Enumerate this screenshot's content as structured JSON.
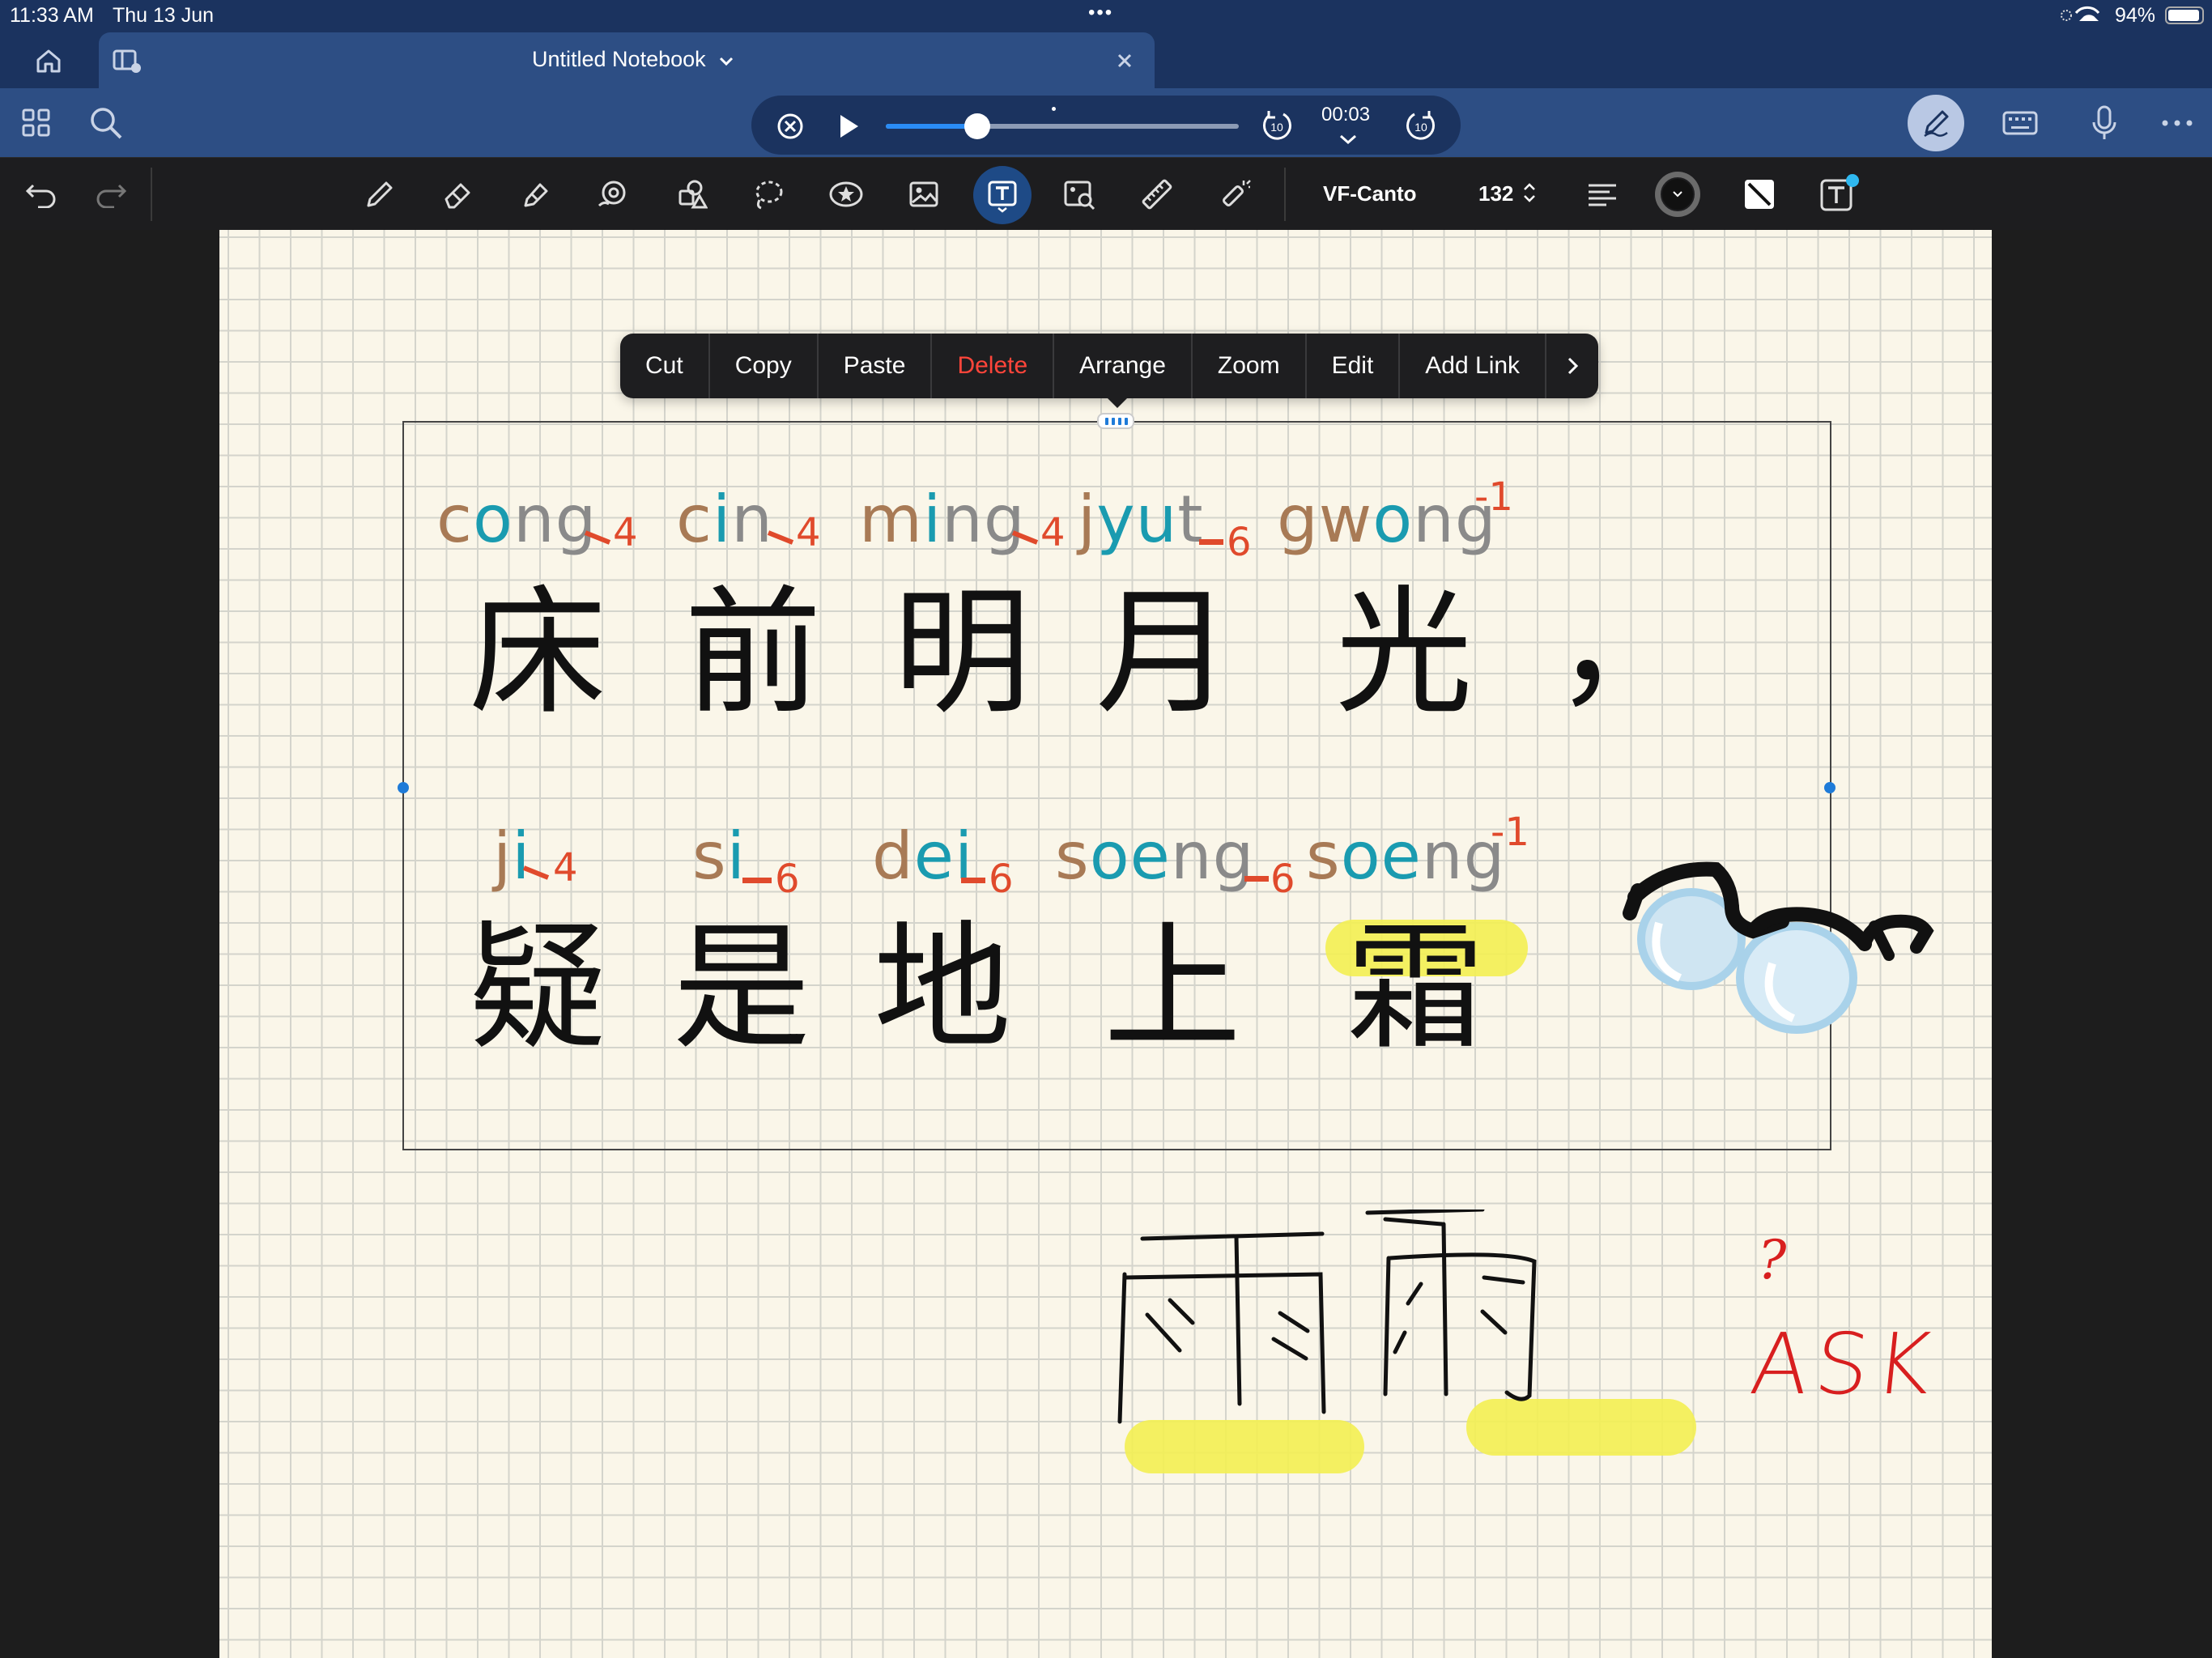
{
  "status_bar": {
    "time": "11:33 AM",
    "date": "Thu 13 Jun",
    "battery": "94%"
  },
  "tab": {
    "title": "Untitled Notebook"
  },
  "player": {
    "time": "00:03",
    "skip_back": "10",
    "skip_fwd": "10",
    "progress": 0.26
  },
  "toolbar": {
    "font": "VF-Canto",
    "size": "132"
  },
  "menu": {
    "cut": "Cut",
    "copy": "Copy",
    "paste": "Paste",
    "delete": "Delete",
    "arrange": "Arrange",
    "zoom": "Zoom",
    "edit": "Edit",
    "add_link": "Add Link"
  },
  "poem": {
    "line1": [
      {
        "han": "床",
        "p1": "c",
        "p2": "o",
        "p3": "ng",
        "tone": "4"
      },
      {
        "han": "前",
        "p1": "c",
        "p2": "i",
        "p3": "n",
        "tone": "4"
      },
      {
        "han": "明",
        "p1": "m",
        "p2": "i",
        "p3": "ng",
        "tone": "4"
      },
      {
        "han": "月",
        "p1": "j",
        "p2": "yu",
        "p3": "t",
        "tone": "6"
      },
      {
        "han": "光",
        "p1": "gw",
        "p2": "o",
        "p3": "ng",
        "tone": "-1"
      }
    ],
    "line1_punct": "，",
    "line2": [
      {
        "han": "疑",
        "p1": "j",
        "p2": "i",
        "p3": "",
        "tone": "4"
      },
      {
        "han": "是",
        "p1": "s",
        "p2": "i",
        "p3": "",
        "tone": "6"
      },
      {
        "han": "地",
        "p1": "d",
        "p2": "ei",
        "p3": "",
        "tone": "6"
      },
      {
        "han": "上",
        "p1": "s",
        "p2": "oe",
        "p3": "ng",
        "tone": "6"
      },
      {
        "han": "霜",
        "p1": "s",
        "p2": "oe",
        "p3": "ng",
        "tone": "-1"
      }
    ]
  },
  "handwriting": {
    "char": "雨",
    "question": "?",
    "ask": "ASK"
  }
}
